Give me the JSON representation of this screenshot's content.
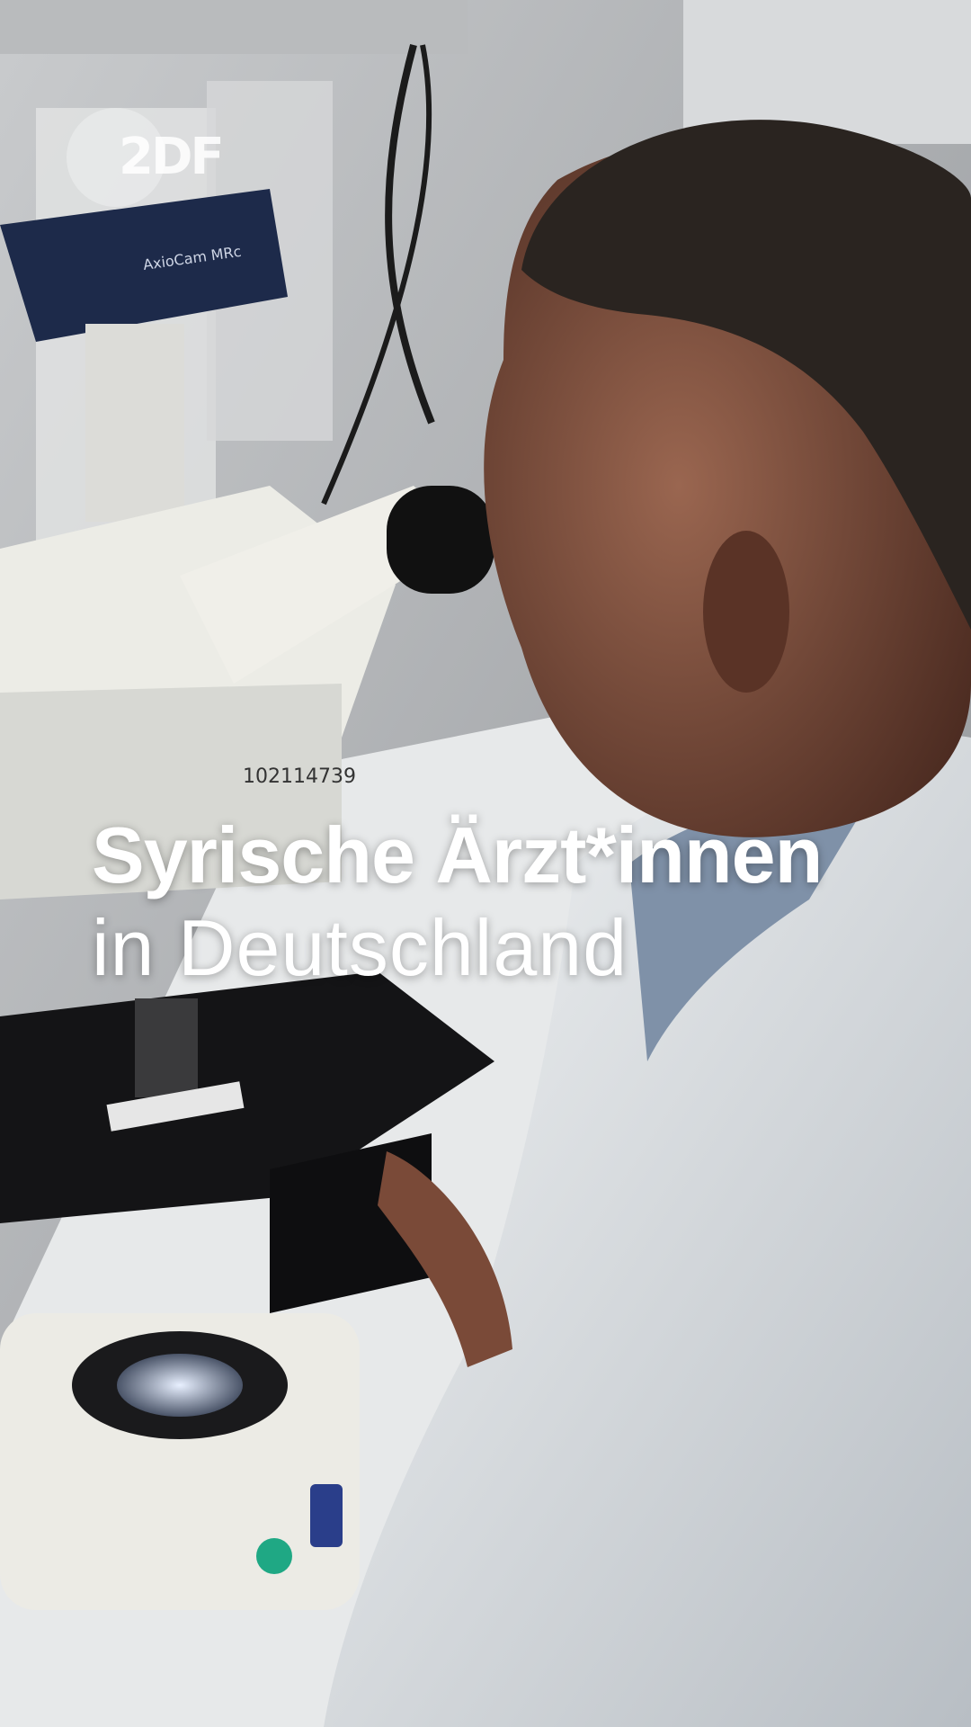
{
  "logo": {
    "text": "2DF"
  },
  "headline": {
    "line1": "Syrische Ärzt*innen",
    "line2": "in Deutschland"
  },
  "scene": {
    "microscope_label": "AxioCam MRc",
    "serial": "102114739"
  },
  "colors": {
    "text": "#ffffff",
    "coat": "#e9ecee",
    "skin": "#8a5a45",
    "hair": "#2a2420",
    "accent_dot": "#1fa884"
  }
}
